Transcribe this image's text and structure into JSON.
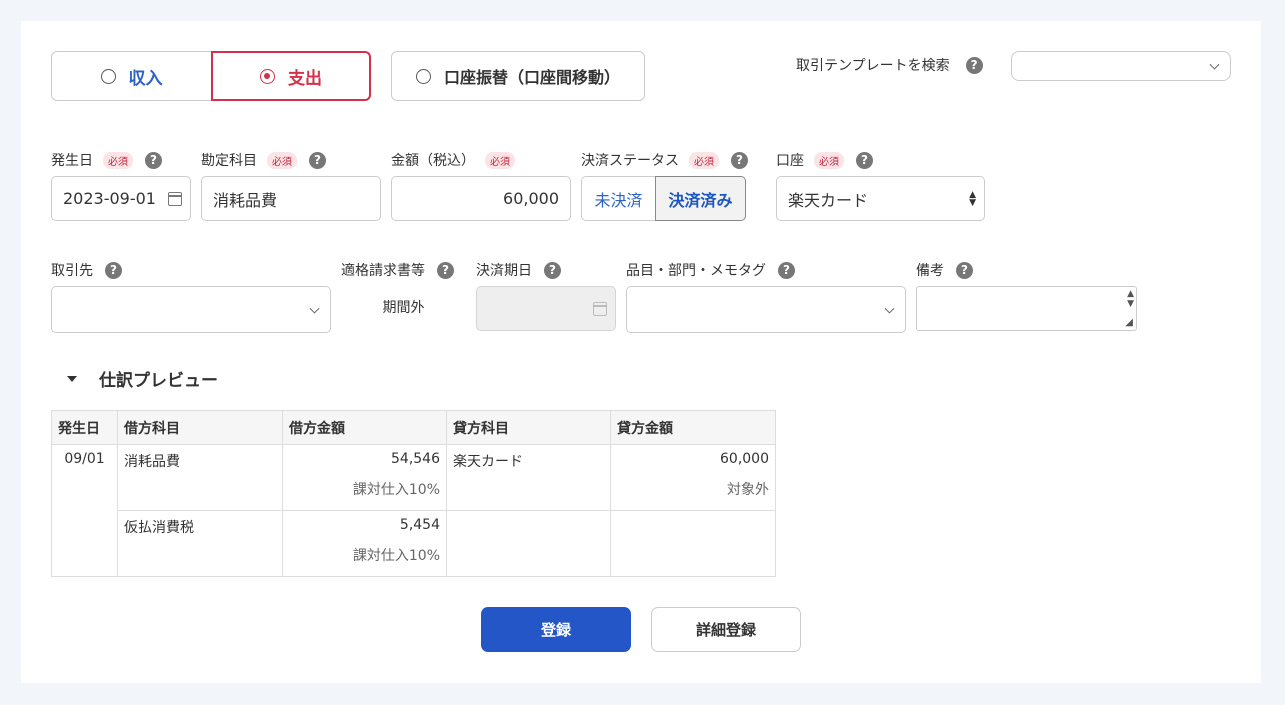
{
  "tx_type": {
    "income": "収入",
    "expense": "支出",
    "transfer": "口座振替（口座間移動）"
  },
  "template_search": {
    "label": "取引テンプレートを検索",
    "value": ""
  },
  "help_glyph": "?",
  "required_badge": "必須",
  "fields": {
    "date": {
      "label": "発生日",
      "value": "2023-09-01"
    },
    "account_item": {
      "label": "勘定科目",
      "value": "消耗品費"
    },
    "amount": {
      "label": "金額（税込）",
      "value": "60,000"
    },
    "settlement_status": {
      "label": "決済ステータス",
      "unsettled": "未決済",
      "settled": "決済済み",
      "selected": "決済済み"
    },
    "wallet": {
      "label": "口座",
      "value": "楽天カード"
    },
    "partner": {
      "label": "取引先",
      "value": ""
    },
    "invoice": {
      "label": "適格請求書等",
      "value": "期間外"
    },
    "due_date": {
      "label": "決済期日",
      "value": ""
    },
    "tags": {
      "label": "品目・部門・メモタグ",
      "value": ""
    },
    "memo": {
      "label": "備考",
      "value": ""
    }
  },
  "preview": {
    "title": "仕訳プレビュー",
    "headers": [
      "発生日",
      "借方科目",
      "借方金額",
      "貸方科目",
      "貸方金額"
    ],
    "date": "09/01",
    "rows": [
      {
        "debit_item": "消耗品費",
        "debit_amount": "54,546",
        "debit_tax": "課対仕入10%",
        "credit_item": "楽天カード",
        "credit_amount": "60,000",
        "credit_tax": "対象外"
      },
      {
        "debit_item": "仮払消費税",
        "debit_amount": "5,454",
        "debit_tax": "課対仕入10%",
        "credit_item": "",
        "credit_amount": "",
        "credit_tax": ""
      }
    ]
  },
  "buttons": {
    "register": "登録",
    "detail_register": "詳細登録"
  },
  "colors": {
    "income_blue": "#2b63c9",
    "expense_red": "#d5304a",
    "primary": "#2456c7"
  }
}
